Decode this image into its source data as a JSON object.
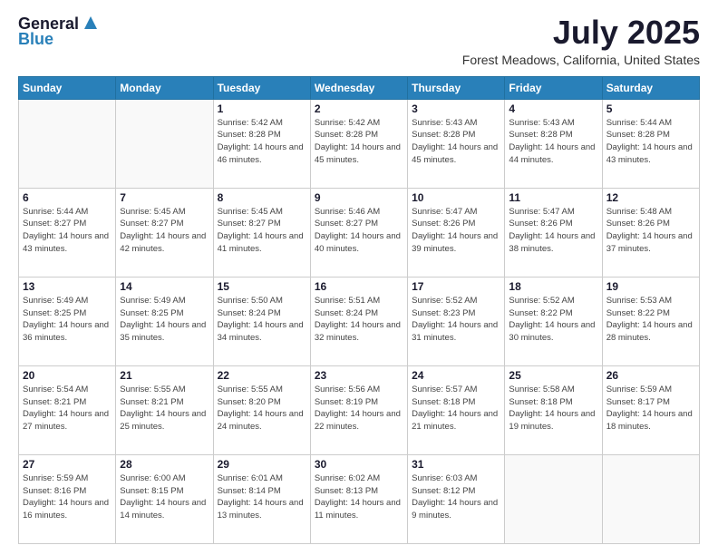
{
  "header": {
    "logo_general": "General",
    "logo_blue": "Blue",
    "title": "July 2025",
    "location": "Forest Meadows, California, United States"
  },
  "days_of_week": [
    "Sunday",
    "Monday",
    "Tuesday",
    "Wednesday",
    "Thursday",
    "Friday",
    "Saturday"
  ],
  "weeks": [
    [
      {
        "day": "",
        "content": ""
      },
      {
        "day": "",
        "content": ""
      },
      {
        "day": "1",
        "sunrise": "5:42 AM",
        "sunset": "8:28 PM",
        "daylight": "14 hours and 46 minutes."
      },
      {
        "day": "2",
        "sunrise": "5:42 AM",
        "sunset": "8:28 PM",
        "daylight": "14 hours and 45 minutes."
      },
      {
        "day": "3",
        "sunrise": "5:43 AM",
        "sunset": "8:28 PM",
        "daylight": "14 hours and 45 minutes."
      },
      {
        "day": "4",
        "sunrise": "5:43 AM",
        "sunset": "8:28 PM",
        "daylight": "14 hours and 44 minutes."
      },
      {
        "day": "5",
        "sunrise": "5:44 AM",
        "sunset": "8:28 PM",
        "daylight": "14 hours and 43 minutes."
      }
    ],
    [
      {
        "day": "6",
        "sunrise": "5:44 AM",
        "sunset": "8:27 PM",
        "daylight": "14 hours and 43 minutes."
      },
      {
        "day": "7",
        "sunrise": "5:45 AM",
        "sunset": "8:27 PM",
        "daylight": "14 hours and 42 minutes."
      },
      {
        "day": "8",
        "sunrise": "5:45 AM",
        "sunset": "8:27 PM",
        "daylight": "14 hours and 41 minutes."
      },
      {
        "day": "9",
        "sunrise": "5:46 AM",
        "sunset": "8:27 PM",
        "daylight": "14 hours and 40 minutes."
      },
      {
        "day": "10",
        "sunrise": "5:47 AM",
        "sunset": "8:26 PM",
        "daylight": "14 hours and 39 minutes."
      },
      {
        "day": "11",
        "sunrise": "5:47 AM",
        "sunset": "8:26 PM",
        "daylight": "14 hours and 38 minutes."
      },
      {
        "day": "12",
        "sunrise": "5:48 AM",
        "sunset": "8:26 PM",
        "daylight": "14 hours and 37 minutes."
      }
    ],
    [
      {
        "day": "13",
        "sunrise": "5:49 AM",
        "sunset": "8:25 PM",
        "daylight": "14 hours and 36 minutes."
      },
      {
        "day": "14",
        "sunrise": "5:49 AM",
        "sunset": "8:25 PM",
        "daylight": "14 hours and 35 minutes."
      },
      {
        "day": "15",
        "sunrise": "5:50 AM",
        "sunset": "8:24 PM",
        "daylight": "14 hours and 34 minutes."
      },
      {
        "day": "16",
        "sunrise": "5:51 AM",
        "sunset": "8:24 PM",
        "daylight": "14 hours and 32 minutes."
      },
      {
        "day": "17",
        "sunrise": "5:52 AM",
        "sunset": "8:23 PM",
        "daylight": "14 hours and 31 minutes."
      },
      {
        "day": "18",
        "sunrise": "5:52 AM",
        "sunset": "8:22 PM",
        "daylight": "14 hours and 30 minutes."
      },
      {
        "day": "19",
        "sunrise": "5:53 AM",
        "sunset": "8:22 PM",
        "daylight": "14 hours and 28 minutes."
      }
    ],
    [
      {
        "day": "20",
        "sunrise": "5:54 AM",
        "sunset": "8:21 PM",
        "daylight": "14 hours and 27 minutes."
      },
      {
        "day": "21",
        "sunrise": "5:55 AM",
        "sunset": "8:21 PM",
        "daylight": "14 hours and 25 minutes."
      },
      {
        "day": "22",
        "sunrise": "5:55 AM",
        "sunset": "8:20 PM",
        "daylight": "14 hours and 24 minutes."
      },
      {
        "day": "23",
        "sunrise": "5:56 AM",
        "sunset": "8:19 PM",
        "daylight": "14 hours and 22 minutes."
      },
      {
        "day": "24",
        "sunrise": "5:57 AM",
        "sunset": "8:18 PM",
        "daylight": "14 hours and 21 minutes."
      },
      {
        "day": "25",
        "sunrise": "5:58 AM",
        "sunset": "8:18 PM",
        "daylight": "14 hours and 19 minutes."
      },
      {
        "day": "26",
        "sunrise": "5:59 AM",
        "sunset": "8:17 PM",
        "daylight": "14 hours and 18 minutes."
      }
    ],
    [
      {
        "day": "27",
        "sunrise": "5:59 AM",
        "sunset": "8:16 PM",
        "daylight": "14 hours and 16 minutes."
      },
      {
        "day": "28",
        "sunrise": "6:00 AM",
        "sunset": "8:15 PM",
        "daylight": "14 hours and 14 minutes."
      },
      {
        "day": "29",
        "sunrise": "6:01 AM",
        "sunset": "8:14 PM",
        "daylight": "14 hours and 13 minutes."
      },
      {
        "day": "30",
        "sunrise": "6:02 AM",
        "sunset": "8:13 PM",
        "daylight": "14 hours and 11 minutes."
      },
      {
        "day": "31",
        "sunrise": "6:03 AM",
        "sunset": "8:12 PM",
        "daylight": "14 hours and 9 minutes."
      },
      {
        "day": "",
        "content": ""
      },
      {
        "day": "",
        "content": ""
      }
    ]
  ]
}
